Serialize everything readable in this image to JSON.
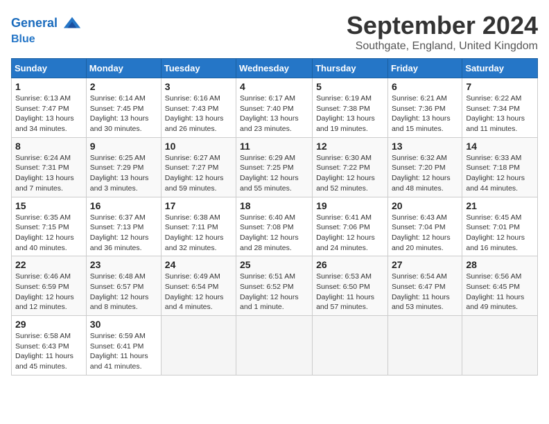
{
  "header": {
    "logo_line1": "General",
    "logo_line2": "Blue",
    "month": "September 2024",
    "location": "Southgate, England, United Kingdom"
  },
  "days_of_week": [
    "Sunday",
    "Monday",
    "Tuesday",
    "Wednesday",
    "Thursday",
    "Friday",
    "Saturday"
  ],
  "weeks": [
    [
      {
        "day": "1",
        "sunrise": "6:13 AM",
        "sunset": "7:47 PM",
        "daylight": "13 hours and 34 minutes."
      },
      {
        "day": "2",
        "sunrise": "6:14 AM",
        "sunset": "7:45 PM",
        "daylight": "13 hours and 30 minutes."
      },
      {
        "day": "3",
        "sunrise": "6:16 AM",
        "sunset": "7:43 PM",
        "daylight": "13 hours and 26 minutes."
      },
      {
        "day": "4",
        "sunrise": "6:17 AM",
        "sunset": "7:40 PM",
        "daylight": "13 hours and 23 minutes."
      },
      {
        "day": "5",
        "sunrise": "6:19 AM",
        "sunset": "7:38 PM",
        "daylight": "13 hours and 19 minutes."
      },
      {
        "day": "6",
        "sunrise": "6:21 AM",
        "sunset": "7:36 PM",
        "daylight": "13 hours and 15 minutes."
      },
      {
        "day": "7",
        "sunrise": "6:22 AM",
        "sunset": "7:34 PM",
        "daylight": "13 hours and 11 minutes."
      }
    ],
    [
      {
        "day": "8",
        "sunrise": "6:24 AM",
        "sunset": "7:31 PM",
        "daylight": "13 hours and 7 minutes."
      },
      {
        "day": "9",
        "sunrise": "6:25 AM",
        "sunset": "7:29 PM",
        "daylight": "13 hours and 3 minutes."
      },
      {
        "day": "10",
        "sunrise": "6:27 AM",
        "sunset": "7:27 PM",
        "daylight": "12 hours and 59 minutes."
      },
      {
        "day": "11",
        "sunrise": "6:29 AM",
        "sunset": "7:25 PM",
        "daylight": "12 hours and 55 minutes."
      },
      {
        "day": "12",
        "sunrise": "6:30 AM",
        "sunset": "7:22 PM",
        "daylight": "12 hours and 52 minutes."
      },
      {
        "day": "13",
        "sunrise": "6:32 AM",
        "sunset": "7:20 PM",
        "daylight": "12 hours and 48 minutes."
      },
      {
        "day": "14",
        "sunrise": "6:33 AM",
        "sunset": "7:18 PM",
        "daylight": "12 hours and 44 minutes."
      }
    ],
    [
      {
        "day": "15",
        "sunrise": "6:35 AM",
        "sunset": "7:15 PM",
        "daylight": "12 hours and 40 minutes."
      },
      {
        "day": "16",
        "sunrise": "6:37 AM",
        "sunset": "7:13 PM",
        "daylight": "12 hours and 36 minutes."
      },
      {
        "day": "17",
        "sunrise": "6:38 AM",
        "sunset": "7:11 PM",
        "daylight": "12 hours and 32 minutes."
      },
      {
        "day": "18",
        "sunrise": "6:40 AM",
        "sunset": "7:08 PM",
        "daylight": "12 hours and 28 minutes."
      },
      {
        "day": "19",
        "sunrise": "6:41 AM",
        "sunset": "7:06 PM",
        "daylight": "12 hours and 24 minutes."
      },
      {
        "day": "20",
        "sunrise": "6:43 AM",
        "sunset": "7:04 PM",
        "daylight": "12 hours and 20 minutes."
      },
      {
        "day": "21",
        "sunrise": "6:45 AM",
        "sunset": "7:01 PM",
        "daylight": "12 hours and 16 minutes."
      }
    ],
    [
      {
        "day": "22",
        "sunrise": "6:46 AM",
        "sunset": "6:59 PM",
        "daylight": "12 hours and 12 minutes."
      },
      {
        "day": "23",
        "sunrise": "6:48 AM",
        "sunset": "6:57 PM",
        "daylight": "12 hours and 8 minutes."
      },
      {
        "day": "24",
        "sunrise": "6:49 AM",
        "sunset": "6:54 PM",
        "daylight": "12 hours and 4 minutes."
      },
      {
        "day": "25",
        "sunrise": "6:51 AM",
        "sunset": "6:52 PM",
        "daylight": "12 hours and 1 minute."
      },
      {
        "day": "26",
        "sunrise": "6:53 AM",
        "sunset": "6:50 PM",
        "daylight": "11 hours and 57 minutes."
      },
      {
        "day": "27",
        "sunrise": "6:54 AM",
        "sunset": "6:47 PM",
        "daylight": "11 hours and 53 minutes."
      },
      {
        "day": "28",
        "sunrise": "6:56 AM",
        "sunset": "6:45 PM",
        "daylight": "11 hours and 49 minutes."
      }
    ],
    [
      {
        "day": "29",
        "sunrise": "6:58 AM",
        "sunset": "6:43 PM",
        "daylight": "11 hours and 45 minutes."
      },
      {
        "day": "30",
        "sunrise": "6:59 AM",
        "sunset": "6:41 PM",
        "daylight": "11 hours and 41 minutes."
      },
      null,
      null,
      null,
      null,
      null
    ]
  ]
}
